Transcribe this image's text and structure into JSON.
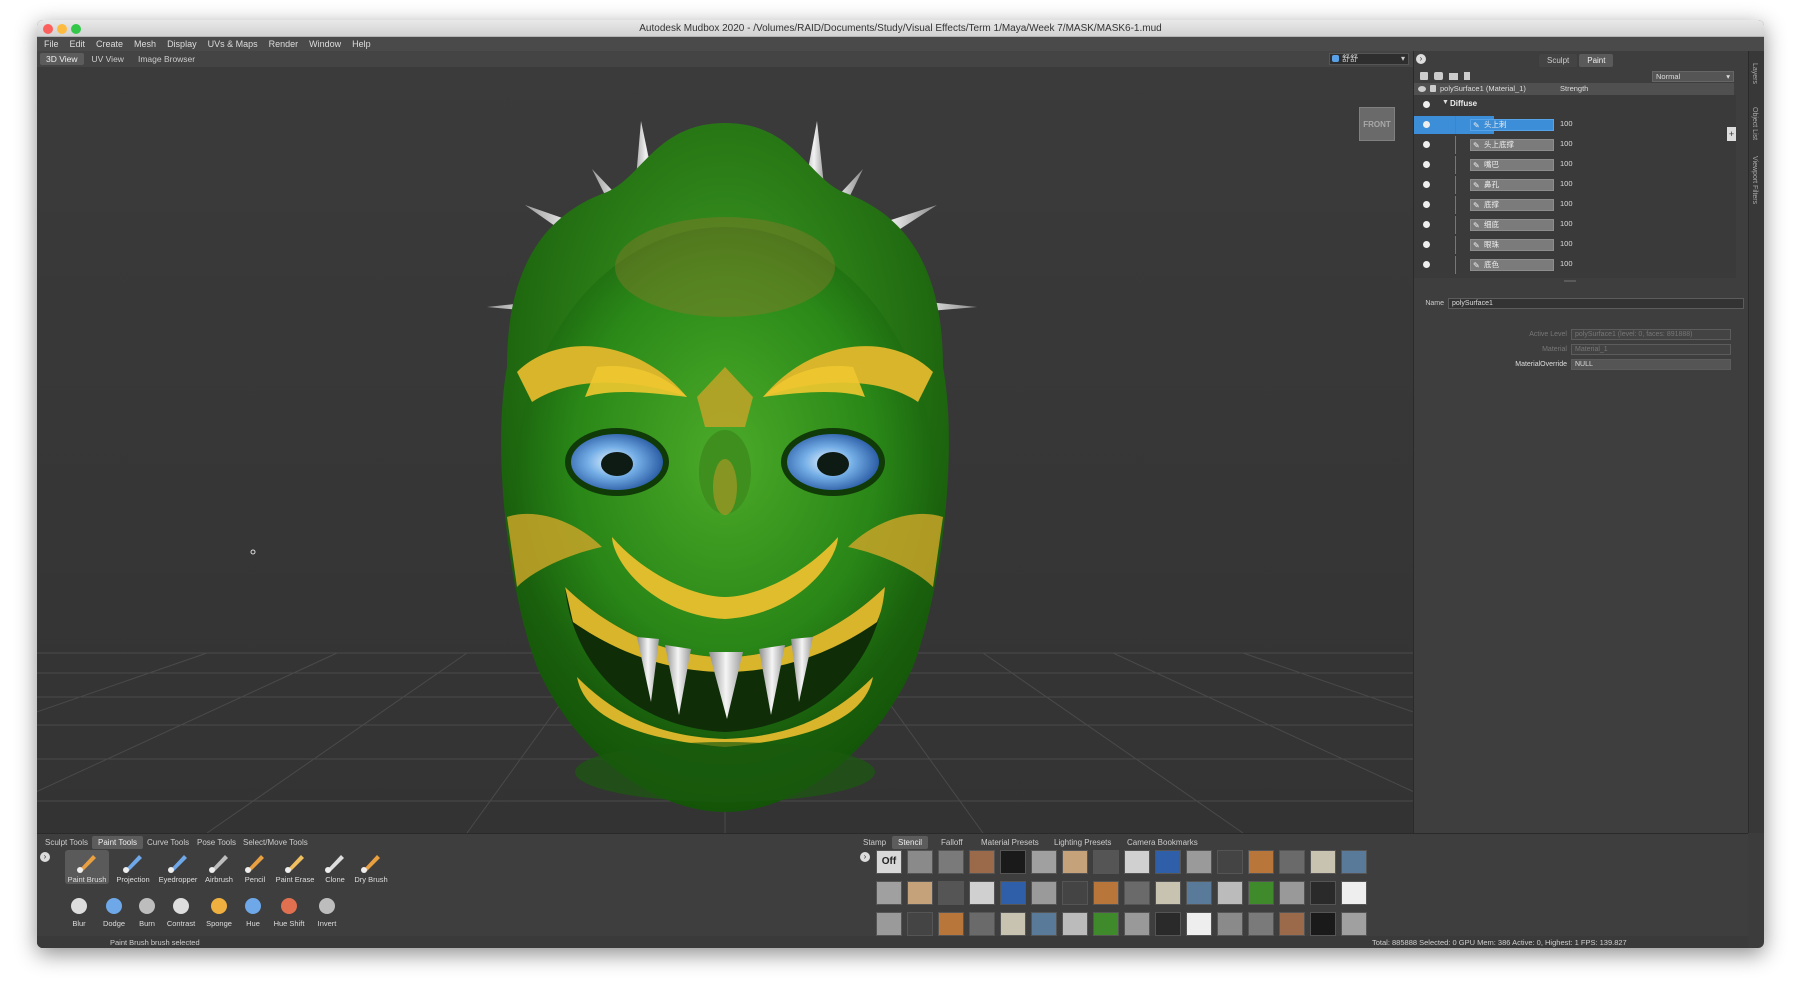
{
  "window": {
    "title": "Autodesk Mudbox 2020 - /Volumes/RAID/Documents/Study/Visual Effects/Term 1/Maya/Week 7/MASK/MASK6-1.mud"
  },
  "menu": [
    "File",
    "Edit",
    "Create",
    "Mesh",
    "Display",
    "UVs & Maps",
    "Render",
    "Window",
    "Help"
  ],
  "view_tabs": [
    "3D View",
    "UV View",
    "Image Browser"
  ],
  "camera": {
    "name": "舒舒"
  },
  "viewport": {
    "front_label": "FRONT"
  },
  "right_panel": {
    "mode_tabs": [
      "Sculpt",
      "Paint"
    ],
    "blend_mode": "Normal",
    "layer_header": {
      "name": "polySurface1 (Material_1)",
      "strength": "Strength"
    },
    "channel": "Diffuse",
    "layers": [
      {
        "name": "头上刺",
        "value": "100",
        "selected": true
      },
      {
        "name": "头上底撑",
        "value": "100",
        "selected": false
      },
      {
        "name": "嘴巴",
        "value": "100",
        "selected": false
      },
      {
        "name": "鼻孔",
        "value": "100",
        "selected": false
      },
      {
        "name": "底撑",
        "value": "100",
        "selected": false
      },
      {
        "name": "细底",
        "value": "100",
        "selected": false
      },
      {
        "name": "眼珠",
        "value": "100",
        "selected": false
      },
      {
        "name": "底色",
        "value": "100",
        "selected": false
      }
    ],
    "props": {
      "name_label": "Name",
      "name_value": "polySurface1",
      "active_level_label": "Active Level",
      "active_level_value": "polySurface1 (level: 0, faces: 891888)",
      "material_label": "Material",
      "material_value": "Material_1",
      "override_label": "MaterialOverride",
      "override_value": "NULL"
    },
    "side_tabs": [
      "Layers",
      "Object List",
      "Viewport Filters"
    ]
  },
  "tool_tabs": [
    "Sculpt Tools",
    "Paint Tools",
    "Curve Tools",
    "Pose Tools",
    "Select/Move Tools"
  ],
  "tools_row1": [
    "Paint Brush",
    "Projection",
    "Eyedropper",
    "Airbrush",
    "Pencil",
    "Paint Erase",
    "Clone",
    "Dry Brush"
  ],
  "tools_row2": [
    "Blur",
    "Dodge",
    "Burn",
    "Contrast",
    "Sponge",
    "Hue",
    "Hue Shift",
    "Invert"
  ],
  "tray_tabs": [
    "Stamp",
    "Stencil",
    "Falloff",
    "Material Presets",
    "Lighting Presets",
    "Camera Bookmarks"
  ],
  "stencil_off": "Off",
  "status": {
    "left": "Paint Brush brush selected",
    "right": "Total: 885888  Selected: 0  GPU Mem: 386  Active: 0, Highest: 1  FPS: 139.827"
  },
  "colors": {
    "selection": "#3d8ed8",
    "mask_green": "#1f7a12",
    "mask_gold": "#d8b52a",
    "eye_blue": "#4f8fd0"
  }
}
